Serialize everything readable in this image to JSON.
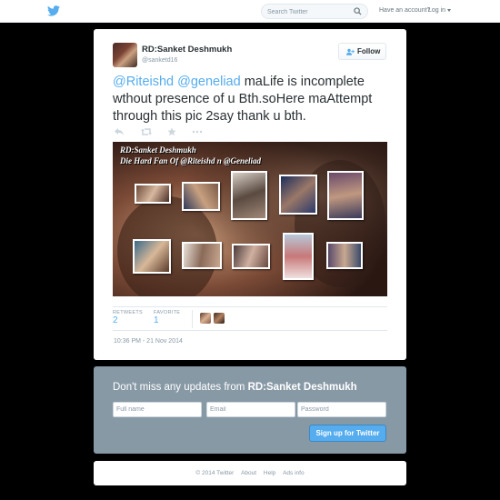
{
  "topbar": {
    "search_placeholder": "Search Twitter",
    "have_account": "Have an account?",
    "login_label": "Log in"
  },
  "tweet": {
    "author_name": "RD:Sanket Deshmukh",
    "author_handle": "@sanketd16",
    "follow_label": "Follow",
    "text": {
      "mention1": "@Riteishd",
      "mention2": "@geneliad",
      "body": " maLife is incomplete wthout presence of u Bth.soHere maAttempt through this pic 2say thank u bth."
    },
    "media": {
      "caption_line1": "RD:Sanket Deshmukh",
      "caption_line2": "Die Hard Fan Of @Riteishd n @Geneliad"
    },
    "stats": {
      "retweets_label": "RETWEETS",
      "retweets_value": "2",
      "favorites_label": "FAVORITE",
      "favorites_value": "1"
    },
    "timestamp": "10:36 PM - 21 Nov 2014"
  },
  "signup": {
    "title_prefix": "Don't miss any updates from ",
    "title_name": "RD:Sanket Deshmukh",
    "fullname_placeholder": "Full name",
    "email_placeholder": "Email",
    "password_placeholder": "Password",
    "button_label": "Sign up for Twitter"
  },
  "footer": {
    "links": [
      "© 2014 Twitter",
      "About",
      "Help",
      "Ads info"
    ]
  },
  "colors": {
    "accent": "#55acee",
    "page_bg": "#000000",
    "signup_bg": "#8899a6"
  },
  "icons": [
    "twitter-bird-icon",
    "search-icon",
    "follow-user-icon",
    "reply-icon",
    "retweet-icon",
    "favorite-icon",
    "more-icon"
  ]
}
